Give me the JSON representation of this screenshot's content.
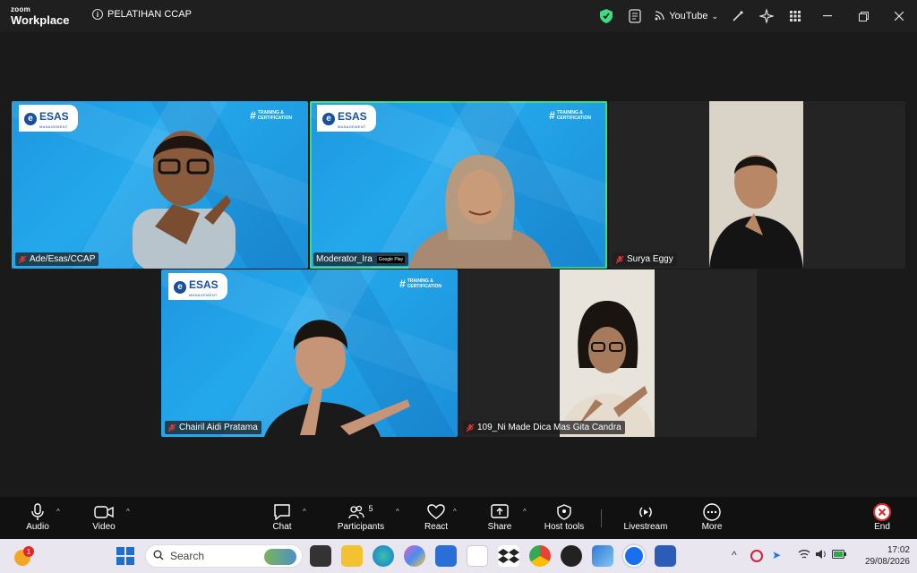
{
  "titlebar": {
    "brand_top": "zoom",
    "brand_bottom": "Workplace",
    "meeting_title": "PELATIHAN CCAP",
    "stream_label": "YouTube",
    "accent": "#3ddc84"
  },
  "tiles": [
    {
      "name": "Ade/Esas/CCAP",
      "muted": true,
      "background": "esas-blue"
    },
    {
      "name": "Moderator_Ira",
      "muted": false,
      "background": "esas-blue",
      "active": true,
      "overlay": "Google Play"
    },
    {
      "name": "Surya Eggy",
      "muted": true,
      "background": "dark"
    },
    {
      "name": "Chairil Aidi Pratama",
      "muted": true,
      "background": "esas-blue"
    },
    {
      "name": "109_Ni Made Dica Mas Gita Candra",
      "muted": true,
      "background": "dark"
    }
  ],
  "branding": {
    "logo_text": "ESAS",
    "logo_sub": "MANAGEMENT",
    "tc_line1": "TRAINING &",
    "tc_line2": "CERTIFICATION"
  },
  "toolbar": {
    "audio": "Audio",
    "video": "Video",
    "chat": "Chat",
    "participants": "Participants",
    "participants_count": "5",
    "react": "React",
    "share": "Share",
    "host_tools": "Host tools",
    "livestream": "Livestream",
    "more": "More",
    "end": "End"
  },
  "taskbar": {
    "search_placeholder": "Search",
    "notification_count": "1",
    "time": "17:02",
    "date": "29/08/2026"
  }
}
